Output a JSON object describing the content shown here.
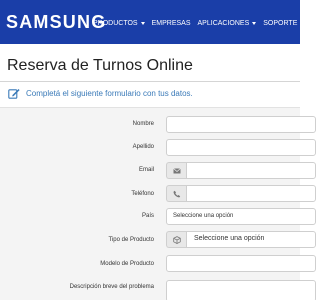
{
  "header": {
    "brand": "SAMSUNG",
    "nav": [
      "PRODUCTOS",
      "EMPRESAS",
      "APLICACIONES",
      "SOPORTE"
    ]
  },
  "page": {
    "title": "Reserva de Turnos Online",
    "intro": "Completá el siguiente formulario con tus datos."
  },
  "form": {
    "nombre_label": "Nombre",
    "apellido_label": "Apellido",
    "email_label": "Email",
    "telefono_label": "Teléfono",
    "pais_label": "País",
    "pais_value": "Seleccione una opción",
    "tipo_label": "Tipo de Producto",
    "tipo_value": "Seleccione una opción",
    "modelo_label": "Modelo de Producto",
    "descripcion_label": "Descripción breve del problema"
  },
  "colors": {
    "header_bg": "#1a3ea8",
    "accent": "#3a7ab8"
  }
}
